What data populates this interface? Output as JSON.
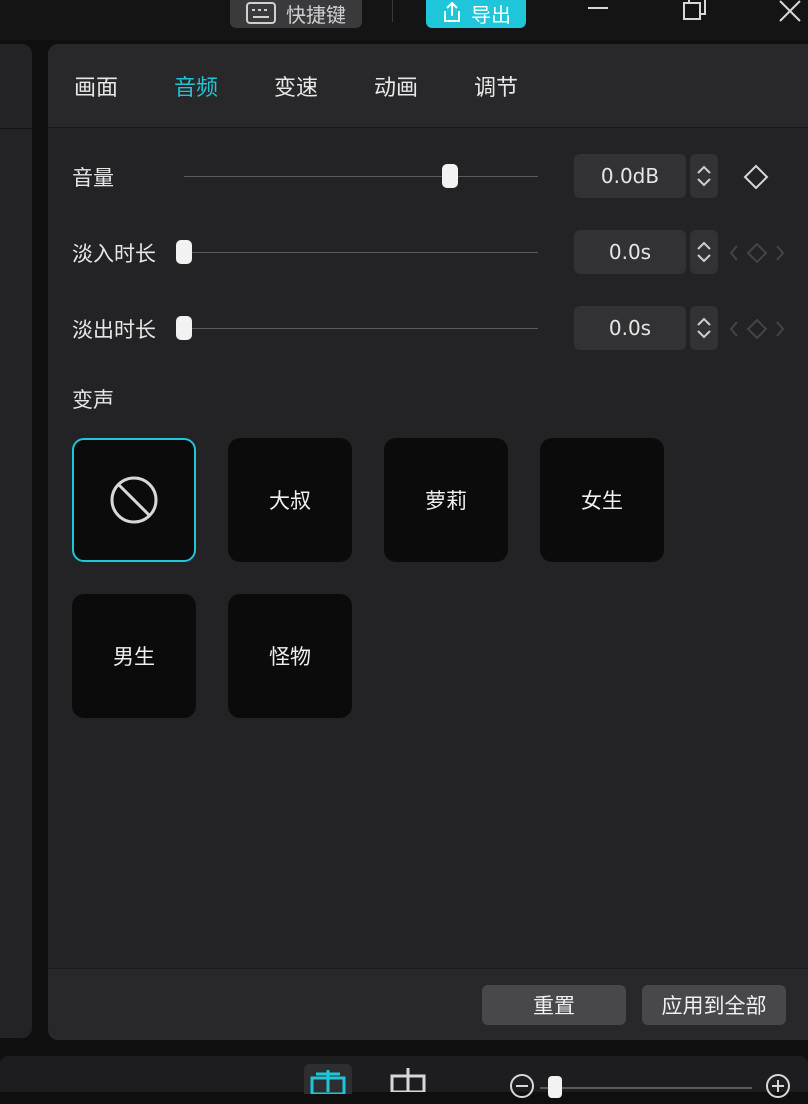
{
  "topbar": {
    "shortcut_label": "快捷键",
    "export_label": "导出"
  },
  "tabs": [
    {
      "label": "画面",
      "active": false
    },
    {
      "label": "音频",
      "active": true
    },
    {
      "label": "变速",
      "active": false
    },
    {
      "label": "动画",
      "active": false
    },
    {
      "label": "调节",
      "active": false
    }
  ],
  "audio": {
    "volume": {
      "label": "音量",
      "value": "0.0dB",
      "slider_fraction": 0.754
    },
    "fade_in": {
      "label": "淡入时长",
      "value": "0.0s",
      "slider_fraction": 0.0
    },
    "fade_out": {
      "label": "淡出时长",
      "value": "0.0s",
      "slider_fraction": 0.0
    }
  },
  "voice_change": {
    "title": "变声",
    "presets": [
      {
        "label": "",
        "icon": "no-effect-icon",
        "selected": true
      },
      {
        "label": "大叔",
        "selected": false
      },
      {
        "label": "萝莉",
        "selected": false
      },
      {
        "label": "女生",
        "selected": false
      },
      {
        "label": "男生",
        "selected": false
      },
      {
        "label": "怪物",
        "selected": false
      }
    ]
  },
  "footer": {
    "reset_label": "重置",
    "apply_all_label": "应用到全部"
  },
  "colors": {
    "accent": "#1fc5d8",
    "panel_bg": "#232325",
    "preset_bg": "#0b0b0c"
  }
}
